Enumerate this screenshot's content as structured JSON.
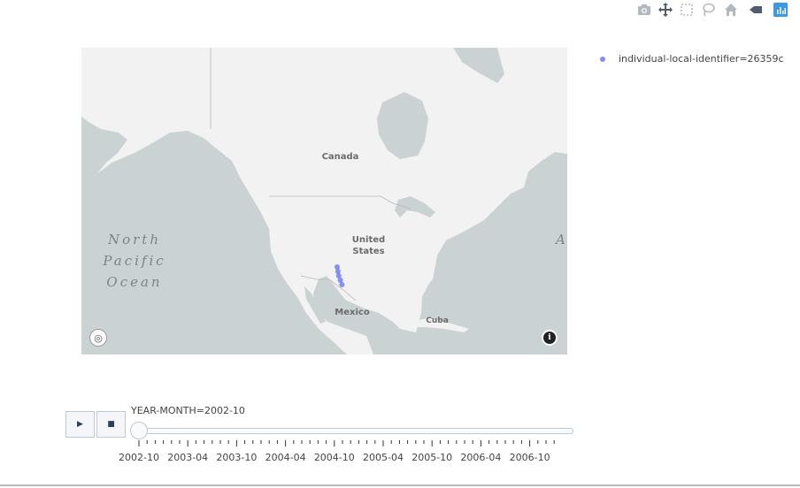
{
  "modebar": {
    "buttons": [
      {
        "name": "camera-icon",
        "title": "Download plot as a png"
      },
      {
        "name": "pan-icon",
        "title": "Pan"
      },
      {
        "name": "box-select-icon",
        "title": "Box Select"
      },
      {
        "name": "lasso-select-icon",
        "title": "Lasso Select"
      },
      {
        "name": "home-icon",
        "title": "Reset view"
      },
      {
        "name": "hover-tag-icon",
        "title": "Show closest data on hover"
      },
      {
        "name": "plotly-logo-icon",
        "title": "Produced with Plotly"
      }
    ]
  },
  "map": {
    "labels": {
      "canada": "Canada",
      "us_line1": "United",
      "us_line2": "States",
      "mexico": "Mexico",
      "cuba": "Cuba",
      "ocean_line1": "North",
      "ocean_line2": "Pacific",
      "ocean_line3": "Ocean",
      "atlantic_partial": "A"
    },
    "colors": {
      "water": "#cad2d3",
      "land": "#f2f2f2",
      "marker": "#636efa"
    },
    "track": {
      "series": "individual-local-identifier=26359c",
      "points": [
        {
          "lon": -104.4,
          "lat": 32.4
        },
        {
          "lon": -104.2,
          "lat": 32.0
        },
        {
          "lon": -104.0,
          "lat": 31.6
        },
        {
          "lon": -103.6,
          "lat": 31.2
        },
        {
          "lon": -103.2,
          "lat": 30.8
        }
      ]
    }
  },
  "legend": {
    "entries": [
      {
        "label": "individual-local-identifier=26359c",
        "color": "#636efa"
      }
    ]
  },
  "slider": {
    "current_value": "YEAR-MONTH=2002-10",
    "play_label": "▶",
    "stop_label": "■",
    "tick_labels": [
      "2002-10",
      "2003-04",
      "2003-10",
      "2004-04",
      "2004-10",
      "2005-04",
      "2005-10",
      "2006-04",
      "2006-10"
    ]
  }
}
